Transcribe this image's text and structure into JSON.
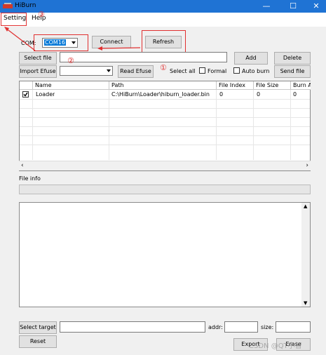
{
  "window": {
    "title": "HiBurn",
    "minimize": "—",
    "maximize": "☐",
    "close": "✕"
  },
  "menu": {
    "setting": "Setting",
    "help": "Help"
  },
  "annotations": {
    "n1": "①",
    "n2": "②",
    "n3": "③",
    "accent": "#e03030"
  },
  "com": {
    "label": "COM:",
    "selected": "COM16",
    "connect": "Connect",
    "refresh": "Refresh"
  },
  "file": {
    "select_file": "Select file",
    "path_value": "",
    "add": "Add",
    "delete": "Delete"
  },
  "efuse": {
    "import": "Import Efuse",
    "combo_value": "",
    "read": "Read Efuse",
    "select_all": "Select all",
    "formal": "Formal",
    "auto_burn": "Auto burn",
    "send_file": "Send file"
  },
  "table": {
    "columns": [
      "Name",
      "Path",
      "File Index",
      "File Size",
      "Burn A"
    ],
    "rows": [
      {
        "checked": true,
        "name": "Loader",
        "path": "C:\\HiBurn\\Loader\\hiburn_loader.bin",
        "index": "0",
        "size": "0",
        "burn": "0"
      }
    ]
  },
  "file_info": {
    "label": "File info"
  },
  "bottom": {
    "select_target": "Select target",
    "target_value": "",
    "addr_label": "addr:",
    "addr_value": "",
    "size_label": "size:",
    "size_value": "",
    "reset": "Reset",
    "export": "Export",
    "erase": "Erase",
    "watermark": "CSDN @QT小智"
  }
}
